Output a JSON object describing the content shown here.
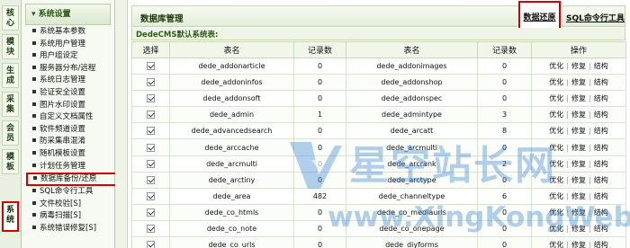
{
  "side_tabs": [
    "核心",
    "模块",
    "生成",
    "采集",
    "会员",
    "模板",
    "系统"
  ],
  "menu": {
    "header": "系统设置",
    "items": [
      "系统基本参数",
      "系统用户管理",
      "用户组设定",
      "服务器分布/远程",
      "系统日志管理",
      "验证安全设置",
      "图片水印设置",
      "自定义文档属性",
      "软件频道设置",
      "防采集串混淆",
      "随机模板设置",
      "计划任务管理",
      "数据库备份/还原",
      "SQL命令行工具",
      "文件校验[S]",
      "病毒扫描[S]",
      "系统错误修复[S]"
    ]
  },
  "main": {
    "title": "数据库管理",
    "restore_link": "数据还原",
    "sql_link": "SQL命令行工具",
    "subtitle": "DedeCMS默认系统表:",
    "headers": [
      "选择",
      "表名",
      "记录数",
      "表名",
      "记录数",
      "操作"
    ],
    "op_labels": [
      "优化",
      "修复",
      "结构"
    ],
    "rows": [
      [
        "dede_addonarticle",
        "0",
        "dede_addonimages",
        "0"
      ],
      [
        "dede_addoninfos",
        "0",
        "dede_addonshop",
        "0"
      ],
      [
        "dede_addonsoft",
        "0",
        "dede_addonspec",
        "0"
      ],
      [
        "dede_admin",
        "1",
        "dede_admintype",
        "3"
      ],
      [
        "dede_advancedsearch",
        "0",
        "dede_arcatt",
        "8"
      ],
      [
        "dede_arccache",
        "0",
        "dede_arcmulti",
        "0"
      ],
      [
        "dede_arcmulti",
        "0",
        "dede_arcrank",
        "2"
      ],
      [
        "dede_arctiny",
        "0",
        "dede_arctype",
        "0"
      ],
      [
        "dede_area",
        "482",
        "dede_channeltype",
        "6"
      ],
      [
        "dede_co_htmls",
        "0",
        "dede_co_mediaurls",
        "0"
      ],
      [
        "dede_co_note",
        "0",
        "dede_co_onepage",
        "0"
      ],
      [
        "dede_co_urls",
        "0",
        "dede_diyforms",
        "0"
      ]
    ]
  },
  "watermark": {
    "text": "星空站长网",
    "url": "www.XingKongWeb.com",
    "color": "#468cd2"
  },
  "colors": {
    "highlight": "#d40000",
    "accent": "#2d5a1a"
  }
}
